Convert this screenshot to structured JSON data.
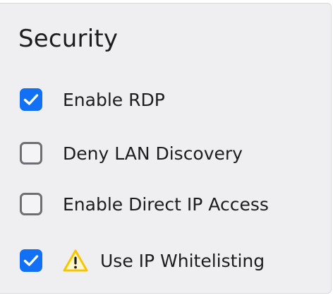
{
  "section": {
    "title": "Security"
  },
  "options": [
    {
      "label": "Enable RDP",
      "checked": true,
      "icon": ""
    },
    {
      "label": "Deny LAN Discovery",
      "checked": false,
      "icon": ""
    },
    {
      "label": "Enable Direct IP Access",
      "checked": false,
      "icon": ""
    },
    {
      "label": "Use IP Whitelisting",
      "checked": true,
      "icon": "warning-icon"
    }
  ],
  "colors": {
    "accent": "#1170f4",
    "warning": "#f7c600",
    "panel_bg": "#efeff1"
  }
}
